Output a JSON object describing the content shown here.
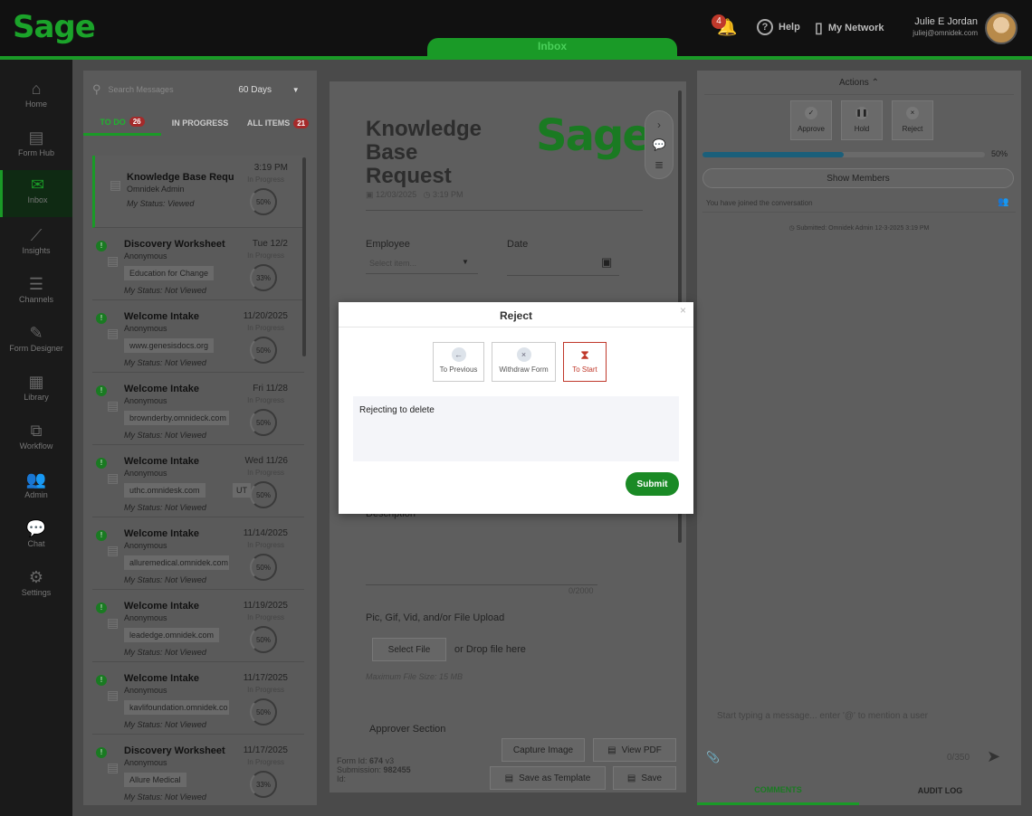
{
  "brand": {
    "logo_text": "Sage",
    "accent": "#1a9a27"
  },
  "topbar": {
    "center_tab": "Inbox",
    "notification_count": "4",
    "help_label": "Help",
    "network_label": "My Network",
    "user_name": "Julie E Jordan",
    "user_email": "juliej@omnidek.com"
  },
  "sidebar": {
    "items": [
      {
        "label": "Home",
        "icon": "home-icon"
      },
      {
        "label": "Form Hub",
        "icon": "form-hub-icon"
      },
      {
        "label": "Inbox",
        "icon": "inbox-icon"
      },
      {
        "label": "Insights",
        "icon": "insights-icon"
      },
      {
        "label": "Channels",
        "icon": "channels-icon"
      },
      {
        "label": "Form Designer",
        "icon": "form-designer-icon"
      },
      {
        "label": "Library",
        "icon": "library-icon"
      },
      {
        "label": "Workflow",
        "icon": "workflow-icon"
      },
      {
        "label": "Admin",
        "icon": "admin-icon"
      },
      {
        "label": "Chat",
        "icon": "chat-icon"
      },
      {
        "label": "Settings",
        "icon": "settings-icon"
      }
    ],
    "active": "Inbox"
  },
  "left": {
    "search_placeholder": "Search Messages",
    "days_filter": "60 Days",
    "tabs": [
      {
        "label": "TO DO",
        "badge": "26"
      },
      {
        "label": "IN PROGRESS",
        "badge": ""
      },
      {
        "label": "ALL ITEMS",
        "badge": "21"
      }
    ],
    "items": [
      {
        "title": "Knowledge Base Requ",
        "sub": "Omnidek Admin",
        "tag": "",
        "tag2": "",
        "my_status": "My Status: Viewed",
        "date": "3:19 PM",
        "status": "In Progress",
        "progress": "50%",
        "dot": false
      },
      {
        "title": "Discovery Worksheet",
        "sub": "Anonymous",
        "tag": "Education for Change",
        "tag2": "",
        "my_status": "My Status: Not Viewed",
        "date": "Tue 12/2",
        "status": "In Progress",
        "progress": "33%",
        "dot": true
      },
      {
        "title": "Welcome Intake",
        "sub": "Anonymous",
        "tag": "www.genesisdocs.org",
        "tag2": "",
        "my_status": "My Status: Not Viewed",
        "date": "11/20/2025",
        "status": "In Progress",
        "progress": "50%",
        "dot": true
      },
      {
        "title": "Welcome Intake",
        "sub": "Anonymous",
        "tag": "brownderby.omnideck.com",
        "tag2": "",
        "my_status": "My Status: Not Viewed",
        "date": "Fri 11/28",
        "status": "In Progress",
        "progress": "50%",
        "dot": true
      },
      {
        "title": "Welcome Intake",
        "sub": "Anonymous",
        "tag": "uthc.omnidesk.com",
        "tag2": "UT",
        "my_status": "My Status: Not Viewed",
        "date": "Wed 11/26",
        "status": "In Progress",
        "progress": "50%",
        "dot": true
      },
      {
        "title": "Welcome Intake",
        "sub": "Anonymous",
        "tag": "alluremedical.omnidek.com",
        "tag2": "",
        "my_status": "My Status: Not Viewed",
        "date": "11/14/2025",
        "status": "In Progress",
        "progress": "50%",
        "dot": true
      },
      {
        "title": "Welcome Intake",
        "sub": "Anonymous",
        "tag": "leadedge.omnidek.com",
        "tag2": "",
        "my_status": "My Status: Not Viewed",
        "date": "11/19/2025",
        "status": "In Progress",
        "progress": "50%",
        "dot": true
      },
      {
        "title": "Welcome Intake",
        "sub": "Anonymous",
        "tag": "kavlifoundation.omnidek.co",
        "tag2": "",
        "my_status": "My Status: Not Viewed",
        "date": "11/17/2025",
        "status": "In Progress",
        "progress": "50%",
        "dot": true
      },
      {
        "title": "Discovery Worksheet",
        "sub": "Anonymous",
        "tag": "Allure Medical",
        "tag2": "",
        "my_status": "My Status: Not Viewed",
        "date": "11/17/2025",
        "status": "In Progress",
        "progress": "33%",
        "dot": true
      }
    ]
  },
  "form": {
    "title": "Knowledge Base Request",
    "date": "12/03/2025",
    "time": "3:19 PM",
    "employee_label": "Employee",
    "employee_placeholder": "Select item...",
    "date_label": "Date",
    "description_label": "Description",
    "char_count": "0/2000",
    "upload_label": "Pic, Gif, Vid, and/or File Upload",
    "select_file": "Select File",
    "drop_text": "or Drop file here",
    "max_size": "Maximum File Size: 15 MB",
    "approver_section": "Approver Section",
    "capture_image": "Capture Image",
    "view_pdf": "View PDF",
    "save_template": "Save as Template",
    "save": "Save",
    "form_id_label": "Form Id:",
    "form_id": "674",
    "form_id_version": "v3",
    "submission_label": "Submission:",
    "submission": "982455",
    "id_label": "Id:"
  },
  "right": {
    "actions_label": "Actions",
    "approve": "Approve",
    "hold": "Hold",
    "reject": "Reject",
    "progress_pct": "50%",
    "progress_value": 0.5,
    "show_members": "Show Members",
    "joined": "You have joined the conversation",
    "submitted": "Submitted: Omnidek Admin 12-3-2025 3:19 PM",
    "message_placeholder": "Start typing a message... enter '@' to mention a user",
    "counter": "0/350",
    "tab_comments": "COMMENTS",
    "tab_audit": "AUDIT LOG"
  },
  "modal": {
    "title": "Reject",
    "close": "×",
    "option_previous": "To Previous",
    "option_withdraw": "Withdraw Form",
    "option_start": "To Start",
    "reason": "Rejecting to delete",
    "submit": "Submit"
  }
}
